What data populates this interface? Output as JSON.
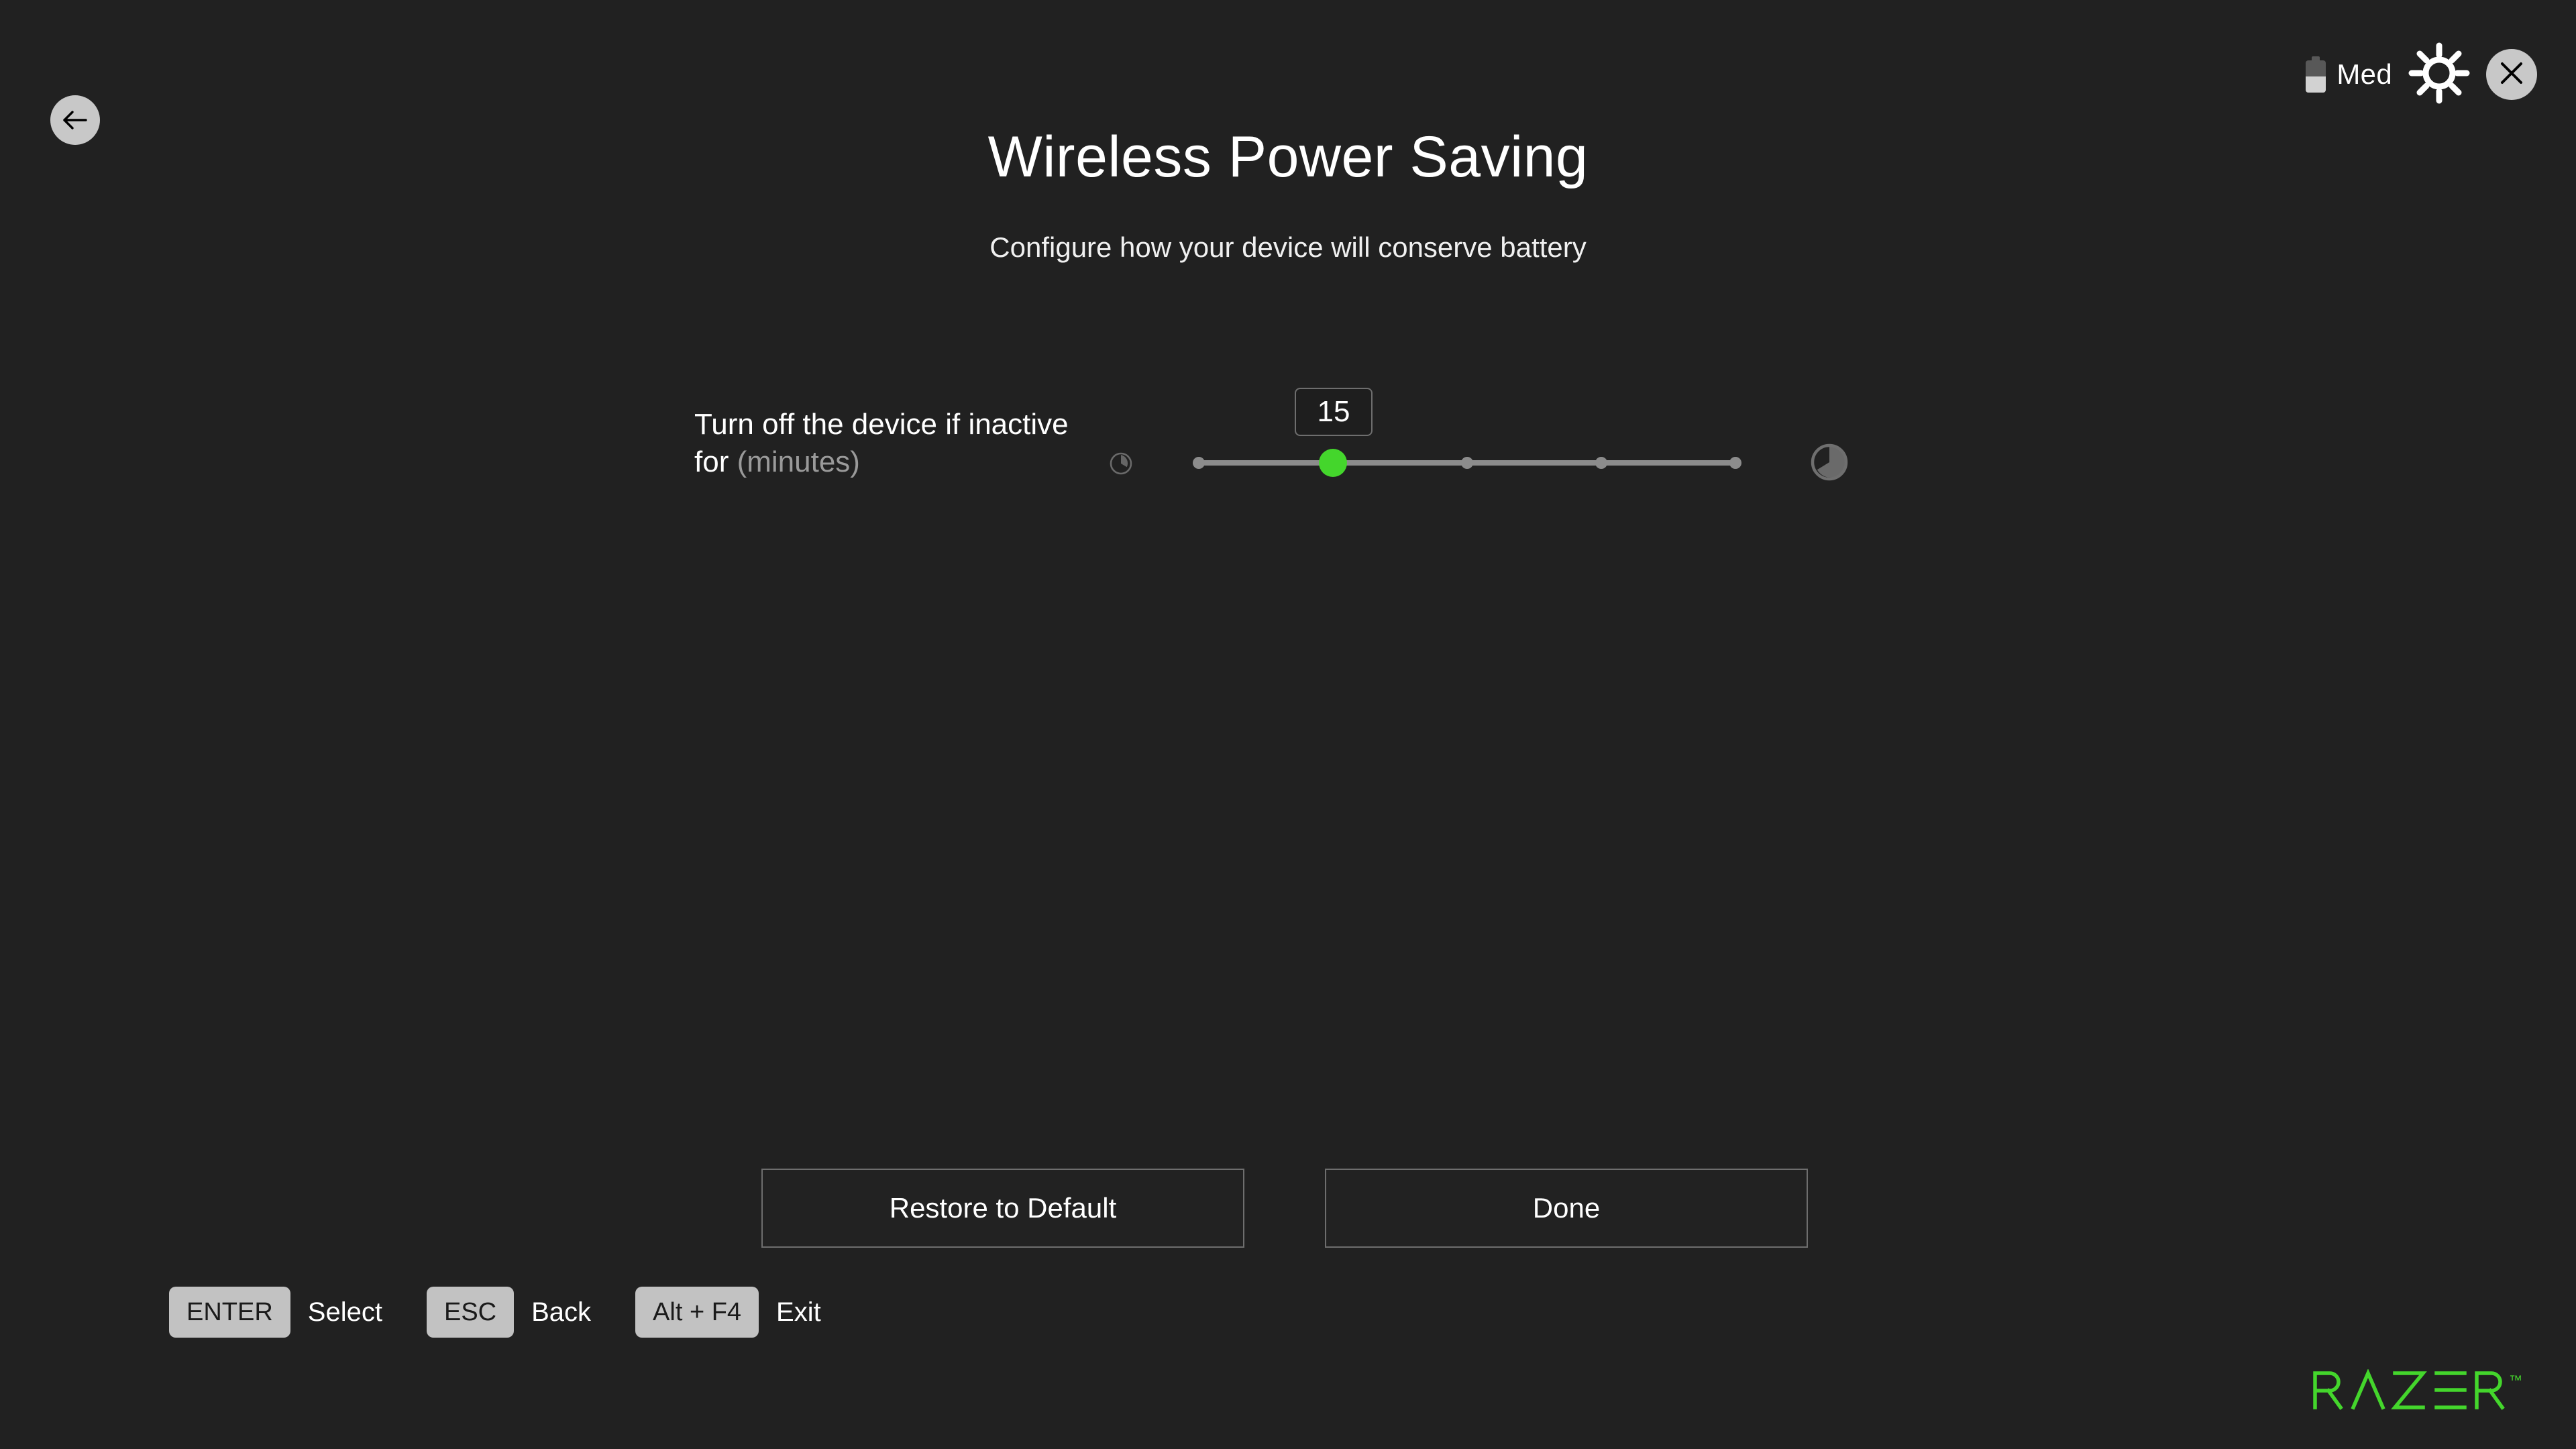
{
  "window": {
    "background_color": "#212121",
    "accent_color": "#44d62c"
  },
  "header": {
    "back_button_label": "Back",
    "back_icon": "arrow-left-icon",
    "title": "Wireless Power Saving",
    "subtitle": "Configure how your device will conserve battery"
  },
  "status_bar": {
    "battery_icon": "battery-half-icon",
    "battery_level_label": "Med",
    "battery_fill_percent": 50,
    "settings_icon": "gear-icon",
    "close_icon": "close-icon"
  },
  "settings": {
    "rows": [
      {
        "label_main": "Turn off the device if inactive for",
        "label_unit": "(minutes)",
        "left_icon": "clock-short-icon",
        "right_icon": "clock-long-icon",
        "value": "15",
        "slider": {
          "min": 1,
          "max": 5,
          "current_step": 2,
          "tick_count": 5,
          "thumb_color": "#44d62c",
          "track_color": "#8c8c8c"
        }
      }
    ]
  },
  "actions": {
    "restore_label": "Restore to Default",
    "done_label": "Done"
  },
  "key_hints": [
    {
      "key": "ENTER",
      "action": "Select"
    },
    {
      "key": "ESC",
      "action": "Back"
    },
    {
      "key": "Alt + F4",
      "action": "Exit"
    }
  ],
  "brand": {
    "name": "RAZER",
    "trademark": "™",
    "color": "#44d62c"
  }
}
